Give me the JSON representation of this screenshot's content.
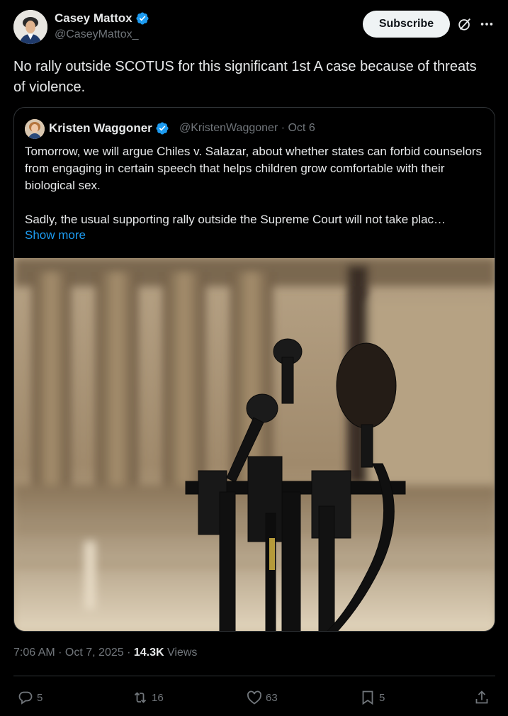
{
  "tweet": {
    "author_name": "Casey Mattox",
    "author_handle": "@CaseyMattox_",
    "subscribe_label": "Subscribe",
    "text": "No rally outside SCOTUS for this significant 1st A case because of threats of violence."
  },
  "quote": {
    "author_name": "Kristen Waggoner",
    "meta": "@KristenWaggoner · Oct 6",
    "text": "Tomorrow, we will argue Chiles v. Salazar, about whether states can forbid counselors from engaging in certain speech that helps children grow comfortable with their biological sex.\n\nSadly, the usual supporting rally outside the Supreme Court will not take plac…",
    "show_more_label": "Show more"
  },
  "footer": {
    "timestamp": "7:06 AM · Oct 7, 2025 · ",
    "views_count": "14.3K",
    "views_label": " Views"
  },
  "actions": {
    "replies": "5",
    "reposts": "16",
    "likes": "63",
    "bookmarks": "5"
  },
  "colors": {
    "background": "#000000",
    "text": "#e7e9ea",
    "muted": "#71767b",
    "link": "#1d9bf0",
    "verified": "#1d9bf0",
    "border": "#2f3336"
  },
  "icons": [
    "verified-badge-icon",
    "grok-icon",
    "more-icon",
    "reply-icon",
    "repost-icon",
    "like-icon",
    "bookmark-icon",
    "share-icon"
  ]
}
